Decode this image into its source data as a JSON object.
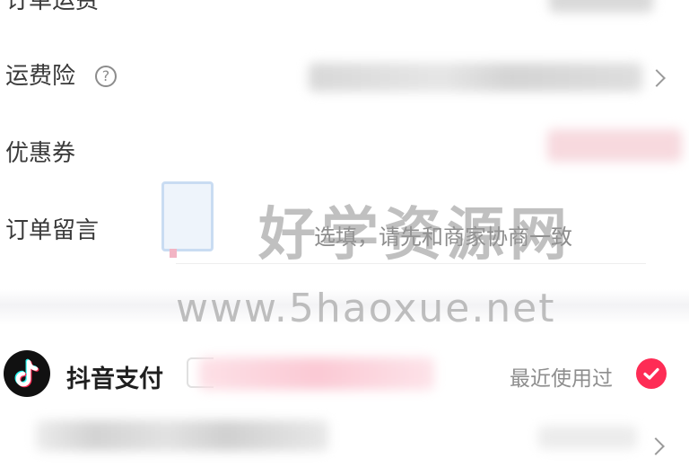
{
  "form": {
    "shipping_fee": {
      "label": "订单运费"
    },
    "shipping_insurance": {
      "label": "运费险",
      "help_icon": "question-circle-icon"
    },
    "coupon": {
      "label": "优惠券"
    },
    "order_message": {
      "label": "订单留言",
      "placeholder": "选填，请先和商家协商一致"
    }
  },
  "payment": {
    "method": {
      "label": "抖音支付",
      "logo_icon": "tiktok-logo-icon",
      "recent_text": "最近使用过",
      "selected": true,
      "check_icon": "check-circle-icon"
    }
  },
  "watermark": {
    "text": "好学资源网",
    "url": "www.5haoxue.net"
  },
  "colors": {
    "accent": "#fe2c55",
    "label_text": "#3a3a3a",
    "muted_text": "#8e8e8e"
  }
}
